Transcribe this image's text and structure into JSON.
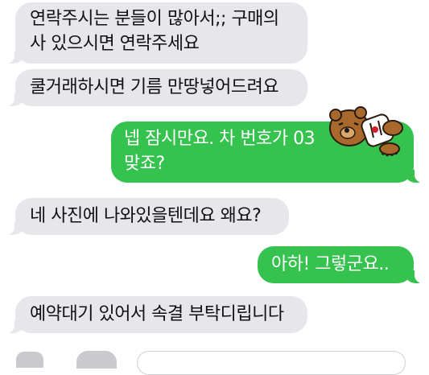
{
  "messages": [
    {
      "direction": "received",
      "lines": [
        "연락주시는 분들이 많아서;; 구매의",
        "사 있으시면 연락주세요"
      ]
    },
    {
      "direction": "received",
      "lines": [
        "쿨거래하시면 기름 만땅넣어드려요"
      ]
    },
    {
      "direction": "sent",
      "lines": [
        "넵 잠시만요. 차 번호가 03",
        "맞죠?"
      ]
    },
    {
      "direction": "received",
      "lines": [
        "네 사진에 나와있을텐데요 왜요?"
      ]
    },
    {
      "direction": "sent",
      "lines": [
        "아하! 그렇군요.."
      ]
    },
    {
      "direction": "received",
      "lines": [
        "예약대기 있어서 속결 부탁디립니다"
      ]
    }
  ],
  "sticker": {
    "icon": "bear-sticker-icon"
  },
  "colors": {
    "received_bg": "#e6e6eb",
    "sent_bg": "#35c24e",
    "received_text": "#111111",
    "sent_text": "#ffffff"
  }
}
